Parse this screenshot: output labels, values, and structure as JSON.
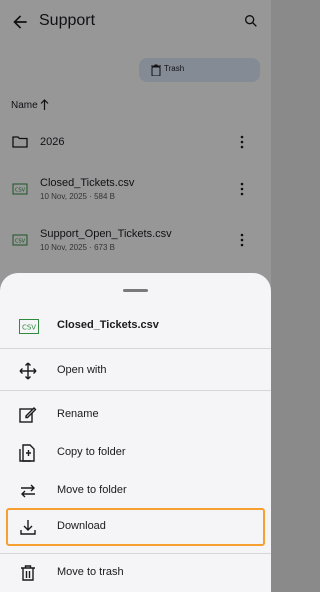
{
  "header": {
    "title": "Support"
  },
  "toolbar": {
    "trash_label": "Trash"
  },
  "sort": {
    "label": "Name"
  },
  "files": [
    {
      "name": "2026",
      "type": "folder"
    },
    {
      "name": "Closed_Tickets.csv",
      "meta": "10 Nov, 2025 · 584 B",
      "type": "csv"
    },
    {
      "name": "Support_Open_Tickets.csv",
      "meta": "10 Nov, 2025 · 673 B",
      "type": "csv"
    }
  ],
  "sheet": {
    "file_name": "Closed_Tickets.csv",
    "actions": [
      {
        "label": "Open with",
        "icon": "open-with-icon"
      },
      {
        "label": "Rename",
        "icon": "edit-icon"
      },
      {
        "label": "Copy to folder",
        "icon": "copy-file-icon"
      },
      {
        "label": "Move to folder",
        "icon": "swap-arrows-icon"
      },
      {
        "label": "Download",
        "icon": "download-icon"
      },
      {
        "label": "Move to trash",
        "icon": "trash-icon"
      }
    ]
  },
  "colors": {
    "highlight": "#f5a030",
    "csv_green": "#2e8b3d",
    "chip_bg": "#d7e1f0"
  }
}
